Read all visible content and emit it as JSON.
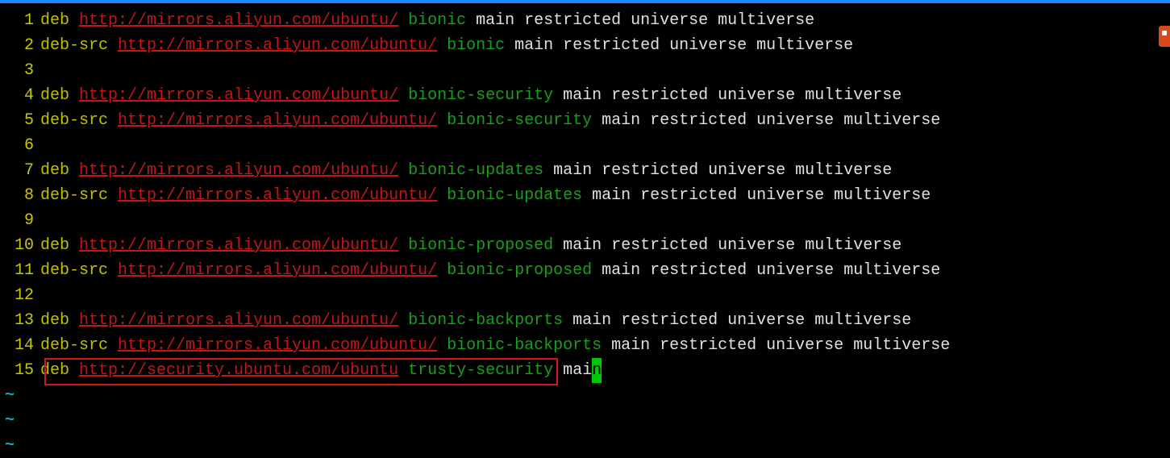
{
  "lines": [
    {
      "num": "1",
      "segs": [
        [
          "t-yellow",
          "deb "
        ],
        [
          "t-red-u",
          "http://mirrors.aliyun.com/ubuntu/"
        ],
        [
          "t-green",
          " bionic "
        ],
        [
          "t-white",
          "main restricted universe multiverse"
        ]
      ]
    },
    {
      "num": "2",
      "segs": [
        [
          "t-yellow",
          "deb-src "
        ],
        [
          "t-red-u",
          "http://mirrors.aliyun.com/ubuntu/"
        ],
        [
          "t-green",
          " bionic "
        ],
        [
          "t-white",
          "main restricted universe multiverse"
        ]
      ]
    },
    {
      "num": "3",
      "segs": []
    },
    {
      "num": "4",
      "segs": [
        [
          "t-yellow",
          "deb "
        ],
        [
          "t-red-u",
          "http://mirrors.aliyun.com/ubuntu/"
        ],
        [
          "t-green",
          " bionic-security "
        ],
        [
          "t-white",
          "main restricted universe multiverse"
        ]
      ]
    },
    {
      "num": "5",
      "segs": [
        [
          "t-yellow",
          "deb-src "
        ],
        [
          "t-red-u",
          "http://mirrors.aliyun.com/ubuntu/"
        ],
        [
          "t-green",
          " bionic-security "
        ],
        [
          "t-white",
          "main restricted universe multiverse"
        ]
      ]
    },
    {
      "num": "6",
      "segs": []
    },
    {
      "num": "7",
      "segs": [
        [
          "t-yellow",
          "deb "
        ],
        [
          "t-red-u",
          "http://mirrors.aliyun.com/ubuntu/"
        ],
        [
          "t-green",
          " bionic-updates "
        ],
        [
          "t-white",
          "main restricted universe multiverse"
        ]
      ]
    },
    {
      "num": "8",
      "segs": [
        [
          "t-yellow",
          "deb-src "
        ],
        [
          "t-red-u",
          "http://mirrors.aliyun.com/ubuntu/"
        ],
        [
          "t-green",
          " bionic-updates "
        ],
        [
          "t-white",
          "main restricted universe multiverse"
        ]
      ]
    },
    {
      "num": "9",
      "segs": []
    },
    {
      "num": "10",
      "segs": [
        [
          "t-yellow",
          "deb "
        ],
        [
          "t-red-u",
          "http://mirrors.aliyun.com/ubuntu/"
        ],
        [
          "t-green",
          " bionic-proposed "
        ],
        [
          "t-white",
          "main restricted universe multiverse"
        ]
      ]
    },
    {
      "num": "11",
      "segs": [
        [
          "t-yellow",
          "deb-src "
        ],
        [
          "t-red-u",
          "http://mirrors.aliyun.com/ubuntu/"
        ],
        [
          "t-green",
          " bionic-proposed "
        ],
        [
          "t-white",
          "main restricted universe multiverse"
        ]
      ]
    },
    {
      "num": "12",
      "segs": []
    },
    {
      "num": "13",
      "segs": [
        [
          "t-yellow",
          "deb "
        ],
        [
          "t-red-u",
          "http://mirrors.aliyun.com/ubuntu/"
        ],
        [
          "t-green",
          " bionic-backports "
        ],
        [
          "t-white",
          "main restricted universe multiverse"
        ]
      ]
    },
    {
      "num": "14",
      "segs": [
        [
          "t-yellow",
          "deb-src "
        ],
        [
          "t-red-u",
          "http://mirrors.aliyun.com/ubuntu/"
        ],
        [
          "t-green",
          " bionic-backports "
        ],
        [
          "t-white",
          "main restricted universe multiverse"
        ]
      ]
    },
    {
      "num": "15",
      "segs": [
        [
          "t-yellow",
          "deb "
        ],
        [
          "t-red-u",
          "http://security.ubuntu.com/ubuntu"
        ],
        [
          "t-green",
          " trusty-security "
        ],
        [
          "t-white",
          "mai"
        ],
        [
          "cursor",
          "n"
        ]
      ]
    }
  ],
  "tildes": [
    "~",
    "~",
    "~"
  ]
}
